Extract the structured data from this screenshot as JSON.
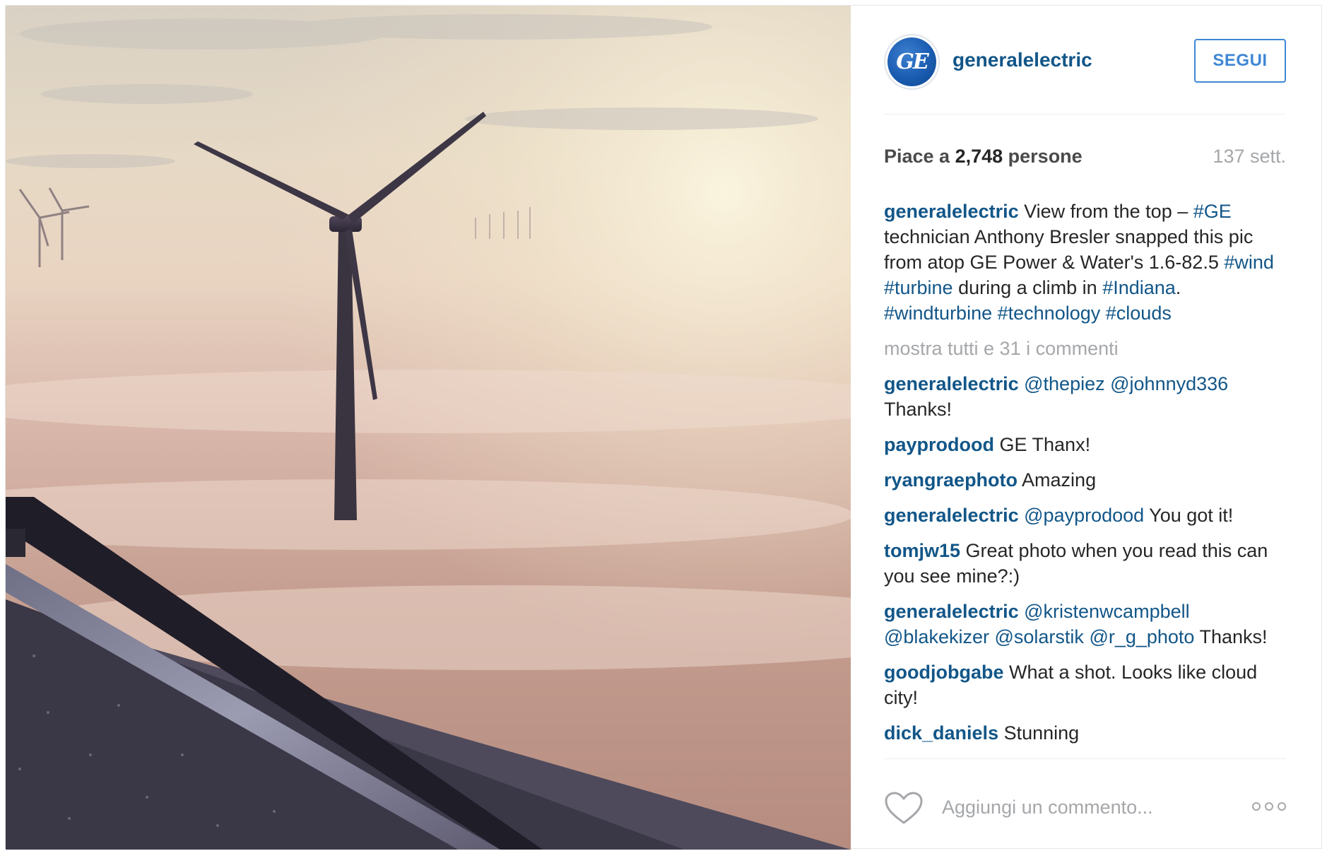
{
  "header": {
    "avatar_text": "GE",
    "username": "generalelectric",
    "follow_label": "SEGUI"
  },
  "meta": {
    "likes_prefix": "Piace a ",
    "likes_count": "2,748",
    "likes_suffix": " persone",
    "time": "137 sett."
  },
  "caption": {
    "user": "generalelectric",
    "text": [
      {
        "t": " View from the top – ",
        "tag": false
      },
      {
        "t": "#GE",
        "tag": true
      },
      {
        "t": " technician Anthony Bresler snapped this pic from atop GE Power & Water's 1.6-82.5 ",
        "tag": false
      },
      {
        "t": "#wind",
        "tag": true
      },
      {
        "t": " ",
        "tag": false
      },
      {
        "t": "#turbine",
        "tag": true
      },
      {
        "t": " during a climb in ",
        "tag": false
      },
      {
        "t": "#Indiana",
        "tag": true
      },
      {
        "t": ". ",
        "tag": false
      },
      {
        "t": "#windturbine",
        "tag": true
      },
      {
        "t": " ",
        "tag": false
      },
      {
        "t": "#technology",
        "tag": true
      },
      {
        "t": " ",
        "tag": false
      },
      {
        "t": "#clouds",
        "tag": true
      }
    ]
  },
  "show_all_label": "mostra tutti e 31 i commenti",
  "comments": [
    {
      "user": "generalelectric",
      "parts": [
        {
          "t": " ",
          "tag": false
        },
        {
          "t": "@thepiez",
          "tag": true
        },
        {
          "t": " ",
          "tag": false
        },
        {
          "t": "@johnnyd336",
          "tag": true
        },
        {
          "t": " Thanks!",
          "tag": false
        }
      ]
    },
    {
      "user": "payprodood",
      "parts": [
        {
          "t": " GE Thanx!",
          "tag": false
        }
      ]
    },
    {
      "user": "ryangraephoto",
      "parts": [
        {
          "t": " Amazing",
          "tag": false
        }
      ]
    },
    {
      "user": "generalelectric",
      "parts": [
        {
          "t": " ",
          "tag": false
        },
        {
          "t": "@payprodood",
          "tag": true
        },
        {
          "t": " You got it!",
          "tag": false
        }
      ]
    },
    {
      "user": "tomjw15",
      "parts": [
        {
          "t": " Great photo when you read this can you see mine?:)",
          "tag": false
        }
      ]
    },
    {
      "user": "generalelectric",
      "parts": [
        {
          "t": " ",
          "tag": false
        },
        {
          "t": "@kristenwcampbell",
          "tag": true
        },
        {
          "t": " ",
          "tag": false
        },
        {
          "t": "@blakekizer",
          "tag": true
        },
        {
          "t": " ",
          "tag": false
        },
        {
          "t": "@solarstik",
          "tag": true
        },
        {
          "t": " ",
          "tag": false
        },
        {
          "t": "@r_g_photo",
          "tag": true
        },
        {
          "t": " Thanks!",
          "tag": false
        }
      ]
    },
    {
      "user": "goodjobgabe",
      "parts": [
        {
          "t": " What a shot. Looks like cloud city!",
          "tag": false
        }
      ]
    },
    {
      "user": "dick_daniels",
      "parts": [
        {
          "t": " Stunning",
          "tag": false
        }
      ]
    }
  ],
  "footer": {
    "comment_placeholder": "Aggiungi un commento..."
  },
  "icons": {
    "like": "heart-icon",
    "options": "more-options-icon"
  },
  "colors": {
    "link": "#125688",
    "follow": "#3f87d4",
    "muted": "#a5a7aa"
  }
}
